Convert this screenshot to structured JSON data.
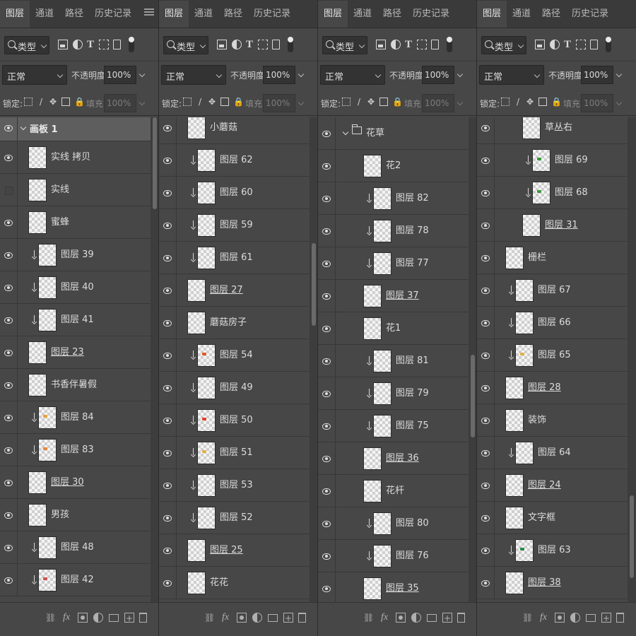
{
  "tabs": [
    "图层",
    "通道",
    "路径",
    "历史记录"
  ],
  "filter": {
    "kind_label": "类型"
  },
  "blend": {
    "mode": "正常",
    "opacity_label": "不透明度:",
    "opacity_value": "100%"
  },
  "lock": {
    "lock_label": "锁定:",
    "fill_label": "填充:",
    "fill_value": "100%"
  },
  "panels": [
    {
      "scroll_top": 0.0,
      "scroll_size": 0.19,
      "rows": [
        {
          "name": "画板 1",
          "type": "artboard",
          "visible": true
        },
        {
          "name": "实线 拷贝",
          "type": "layer",
          "visible": true
        },
        {
          "name": "实线",
          "type": "layer",
          "visible": false
        },
        {
          "name": "蜜蜂",
          "type": "layer",
          "visible": true
        },
        {
          "name": "图层 39",
          "type": "clip",
          "visible": true
        },
        {
          "name": "图层 40",
          "type": "clip",
          "visible": true
        },
        {
          "name": "图层 41",
          "type": "clip",
          "visible": true
        },
        {
          "name": "图层 23",
          "type": "layer",
          "visible": true,
          "underline": true
        },
        {
          "name": "书香伴暑假",
          "type": "layer",
          "visible": true
        },
        {
          "name": "图层 84",
          "type": "clip",
          "visible": true,
          "spot": "#e8a33a"
        },
        {
          "name": "图层 83",
          "type": "clip",
          "visible": true,
          "spot": "#e8843a"
        },
        {
          "name": "图层 30",
          "type": "layer",
          "visible": true,
          "underline": true
        },
        {
          "name": "男孩",
          "type": "layer",
          "visible": true
        },
        {
          "name": "图层 48",
          "type": "clip",
          "visible": true
        },
        {
          "name": "图层 42",
          "type": "clip",
          "visible": true,
          "spot": "#d05050"
        }
      ]
    },
    {
      "scroll_top": 0.26,
      "scroll_size": 0.17,
      "rows": [
        {
          "name": "小蘑菇",
          "type": "layer",
          "visible": true
        },
        {
          "name": "图层 62",
          "type": "clip",
          "visible": true
        },
        {
          "name": "图层 60",
          "type": "clip",
          "visible": true
        },
        {
          "name": "图层 59",
          "type": "clip",
          "visible": true
        },
        {
          "name": "图层 61",
          "type": "clip",
          "visible": true
        },
        {
          "name": "图层 27",
          "type": "layer",
          "visible": true,
          "underline": true
        },
        {
          "name": "蘑菇房子",
          "type": "layer",
          "visible": true
        },
        {
          "name": "图层 54",
          "type": "clip",
          "visible": true,
          "spot": "#e05a2a"
        },
        {
          "name": "图层 49",
          "type": "clip",
          "visible": true
        },
        {
          "name": "图层 50",
          "type": "clip",
          "visible": true,
          "spot": "#e0402a"
        },
        {
          "name": "图层 51",
          "type": "clip",
          "visible": true,
          "spot": "#e0b04a"
        },
        {
          "name": "图层 53",
          "type": "clip",
          "visible": true
        },
        {
          "name": "图层 52",
          "type": "clip",
          "visible": true
        },
        {
          "name": "图层 25",
          "type": "layer",
          "visible": true,
          "underline": true
        },
        {
          "name": "花花",
          "type": "layer",
          "visible": true
        }
      ]
    },
    {
      "scroll_top": 0.49,
      "scroll_size": 0.17,
      "rows": [
        {
          "name": "花草",
          "type": "group",
          "visible": true
        },
        {
          "name": "花2",
          "type": "layer2",
          "visible": true
        },
        {
          "name": "图层 82",
          "type": "clip2",
          "visible": true
        },
        {
          "name": "图层 78",
          "type": "clip2",
          "visible": true
        },
        {
          "name": "图层 77",
          "type": "clip2",
          "visible": true
        },
        {
          "name": "图层 37",
          "type": "layer2",
          "visible": true,
          "underline": true
        },
        {
          "name": "花1",
          "type": "layer2",
          "visible": true
        },
        {
          "name": "图层 81",
          "type": "clip2",
          "visible": true
        },
        {
          "name": "图层 79",
          "type": "clip2",
          "visible": true
        },
        {
          "name": "图层 75",
          "type": "clip2",
          "visible": true
        },
        {
          "name": "图层 36",
          "type": "layer2",
          "visible": true,
          "underline": true
        },
        {
          "name": "花杆",
          "type": "layer2",
          "visible": true
        },
        {
          "name": "图层 80",
          "type": "clip2",
          "visible": true
        },
        {
          "name": "图层 76",
          "type": "clip2",
          "visible": true
        },
        {
          "name": "图层 35",
          "type": "layer2",
          "visible": true,
          "underline": true
        }
      ]
    },
    {
      "scroll_top": 0.78,
      "scroll_size": 0.17,
      "rows": [
        {
          "name": "草丛右",
          "type": "layer2",
          "visible": true
        },
        {
          "name": "图层 69",
          "type": "clip2",
          "visible": true,
          "spot": "#3a9a3a"
        },
        {
          "name": "图层 68",
          "type": "clip2",
          "visible": true,
          "spot": "#3a9a3a"
        },
        {
          "name": "图层 31",
          "type": "layer2",
          "visible": true,
          "underline": true
        },
        {
          "name": "栅栏",
          "type": "layer",
          "visible": true
        },
        {
          "name": "图层 67",
          "type": "clip",
          "visible": true
        },
        {
          "name": "图层 66",
          "type": "clip",
          "visible": true
        },
        {
          "name": "图层 65",
          "type": "clip",
          "visible": true,
          "spot": "#e0b04a"
        },
        {
          "name": "图层 28",
          "type": "layer",
          "visible": true,
          "underline": true
        },
        {
          "name": "装饰",
          "type": "layer",
          "visible": true
        },
        {
          "name": "图层 64",
          "type": "clip",
          "visible": true
        },
        {
          "name": "图层 24",
          "type": "layer",
          "visible": true,
          "underline": true
        },
        {
          "name": "文字框",
          "type": "layer",
          "visible": true
        },
        {
          "name": "图层 63",
          "type": "clip",
          "visible": true,
          "spot": "#2a8a4a"
        },
        {
          "name": "图层 38",
          "type": "layer",
          "visible": true,
          "underline": true
        }
      ]
    }
  ],
  "icons": {
    "filter": [
      "search-icon",
      "image-filter-icon",
      "adjustment-filter-icon",
      "type-filter-icon",
      "shape-filter-icon",
      "smart-object-filter-icon",
      "filter-toggle-icon"
    ],
    "lock": [
      "lock-pixels-icon",
      "lock-paint-icon",
      "lock-move-icon",
      "lock-artboard-icon",
      "lock-all-icon"
    ],
    "bottom": [
      "link-icon",
      "fx-icon",
      "mask-icon",
      "adjustment-icon",
      "group-folder-icon",
      "new-layer-icon",
      "trash-icon"
    ]
  }
}
